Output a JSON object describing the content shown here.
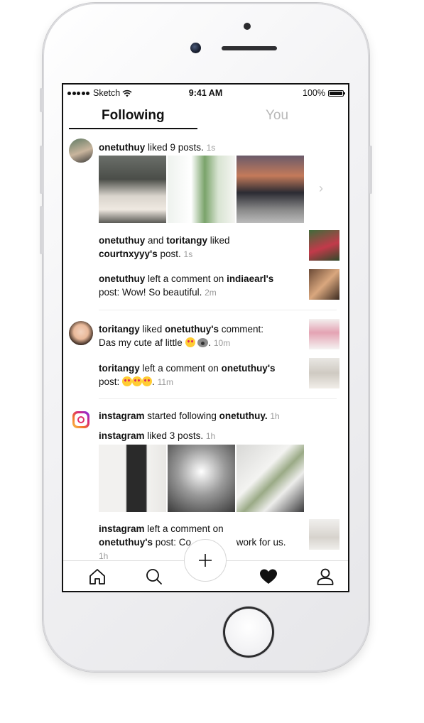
{
  "status_bar": {
    "carrier": "Sketch",
    "time": "9:41 AM",
    "battery": "100%"
  },
  "tabs": {
    "following": "Following",
    "you": "You"
  },
  "feed": {
    "group1": {
      "user": "onetuthuy",
      "action": " liked 9 posts.",
      "time": "1s",
      "item2": {
        "user1": "onetuthuy",
        "and": " and ",
        "user2": "toritangy",
        "liked": " liked",
        "target": "courtnxyyy's",
        "suffix": " post.",
        "time": "1s"
      },
      "item3": {
        "user": "onetuthuy",
        "action": " left a comment on ",
        "target": "indiaearl's",
        "comment": "post: Wow! So beautiful.",
        "time": "2m"
      }
    },
    "group2": {
      "item1": {
        "user": "toritangy",
        "liked": " liked ",
        "target": "onetuthuy's",
        "suffix": " comment:",
        "comment": "Das my cute af little",
        "time": "10m"
      },
      "item2": {
        "user": "toritangy",
        "action": " left a comment on ",
        "target": "onetuthuy's",
        "comment": "post:",
        "time": "11m"
      }
    },
    "group3": {
      "item1": {
        "user": "instagram",
        "action": " started following ",
        "target": "onetuthuy.",
        "time": "1h"
      },
      "item2": {
        "user": "instagram",
        "action": " liked 3 posts.",
        "time": "1h"
      },
      "item3": {
        "user": "instagram",
        "action": " left a comment on",
        "target": "onetuthuy's",
        "comment": " post: Co",
        "comment_rest": " work for us.",
        "time": "1h"
      }
    }
  },
  "bottom_nav": [
    "home-icon",
    "search-icon",
    "plus-icon",
    "heart-icon",
    "profile-icon"
  ],
  "colors": {
    "accent_text": "#111111",
    "muted_text": "#9a9a9a",
    "tab_inactive": "#b8b8b8"
  }
}
